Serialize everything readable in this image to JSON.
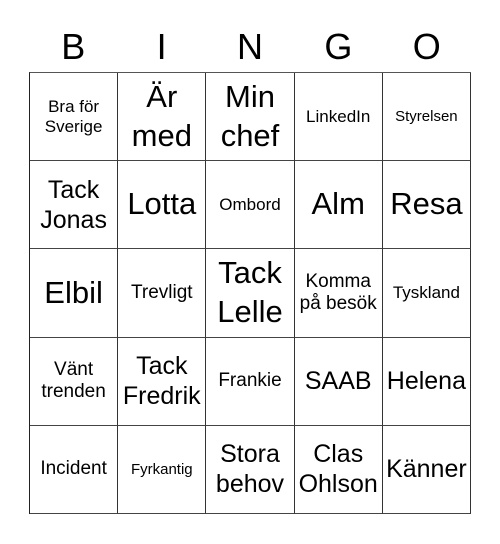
{
  "header": {
    "letters": [
      "B",
      "I",
      "N",
      "G",
      "O"
    ]
  },
  "board": {
    "rows": [
      [
        {
          "text": "Bra för Sverige",
          "size": "s-sm"
        },
        {
          "text": "Är med",
          "size": "s-xl"
        },
        {
          "text": "Min chef",
          "size": "s-xl"
        },
        {
          "text": "LinkedIn",
          "size": "s-sm"
        },
        {
          "text": "Styrelsen",
          "size": "s-xs"
        }
      ],
      [
        {
          "text": "Tack Jonas",
          "size": "s-lg"
        },
        {
          "text": "Lotta",
          "size": "s-xl"
        },
        {
          "text": "Ombord",
          "size": "s-sm"
        },
        {
          "text": "Alm",
          "size": "s-xl"
        },
        {
          "text": "Resa",
          "size": "s-xl"
        }
      ],
      [
        {
          "text": "Elbil",
          "size": "s-xl"
        },
        {
          "text": "Trevligt",
          "size": "s-md"
        },
        {
          "text": "Tack Lelle",
          "size": "s-xl"
        },
        {
          "text": "Komma på besök",
          "size": "s-md"
        },
        {
          "text": "Tyskland",
          "size": "s-sm"
        }
      ],
      [
        {
          "text": "Vänt trenden",
          "size": "s-md"
        },
        {
          "text": "Tack Fredrik",
          "size": "s-lg"
        },
        {
          "text": "Frankie",
          "size": "s-md"
        },
        {
          "text": "SAAB",
          "size": "s-lg"
        },
        {
          "text": "Helena",
          "size": "s-lg"
        }
      ],
      [
        {
          "text": "Incident",
          "size": "s-md"
        },
        {
          "text": "Fyrkantig",
          "size": "s-xs"
        },
        {
          "text": "Stora behov",
          "size": "s-lg"
        },
        {
          "text": "Clas Ohlson",
          "size": "s-lg"
        },
        {
          "text": "Känner",
          "size": "s-lg"
        }
      ]
    ]
  }
}
